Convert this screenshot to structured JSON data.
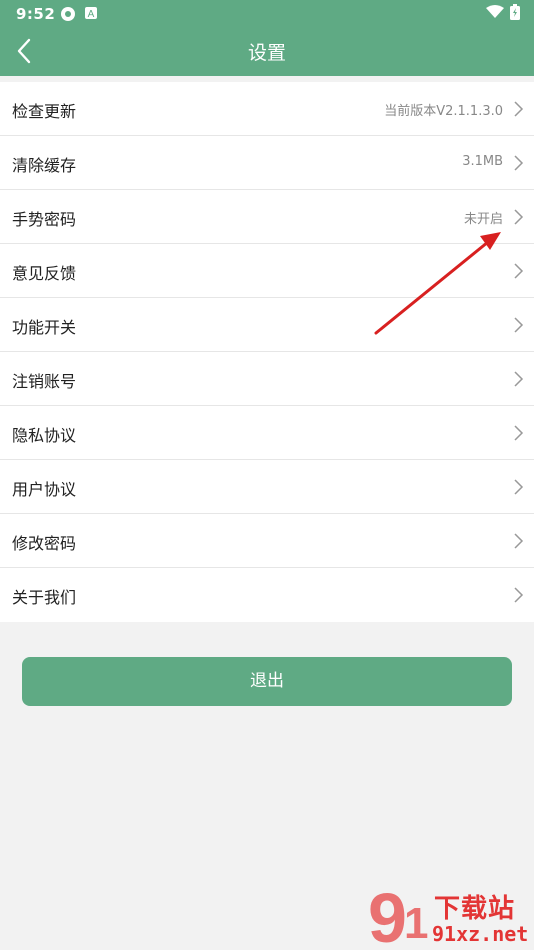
{
  "status_bar": {
    "time": "9:52"
  },
  "header": {
    "title": "设置"
  },
  "settings": [
    {
      "label": "检查更新",
      "value": "当前版本V2.1.1.3.0"
    },
    {
      "label": "清除缓存",
      "value": "3.1MB"
    },
    {
      "label": "手势密码",
      "value": "未开启"
    },
    {
      "label": "意见反馈",
      "value": ""
    },
    {
      "label": "功能开关",
      "value": ""
    },
    {
      "label": "注销账号",
      "value": ""
    },
    {
      "label": "隐私协议",
      "value": ""
    },
    {
      "label": "用户协议",
      "value": ""
    },
    {
      "label": "修改密码",
      "value": ""
    },
    {
      "label": "关于我们",
      "value": ""
    }
  ],
  "logout_label": "退出",
  "watermark": {
    "brand": "下载站",
    "url": "91xz.net"
  },
  "colors": {
    "accent": "#5faa84",
    "annotation_arrow": "#d82020"
  }
}
